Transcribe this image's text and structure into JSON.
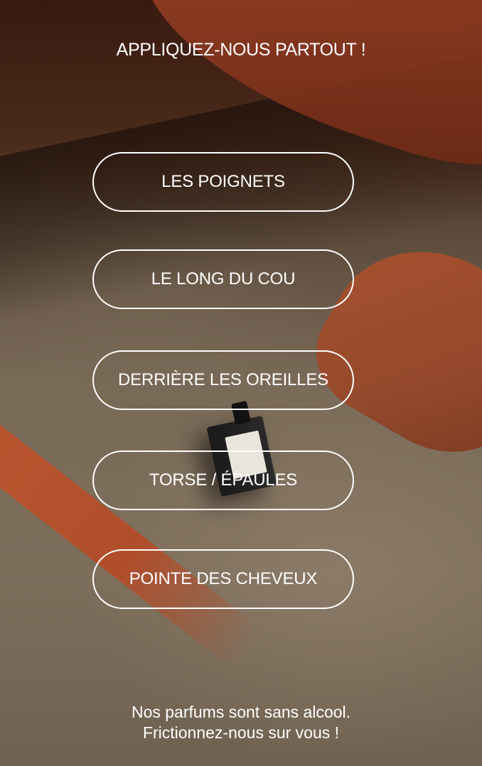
{
  "header": {
    "title": "APPLIQUEZ-NOUS PARTOUT !"
  },
  "options": [
    {
      "label": "LES POIGNETS"
    },
    {
      "label": "LE LONG DU COU"
    },
    {
      "label": "DERRIÈRE LES OREILLES"
    },
    {
      "label": "TORSE / ÉPAULES"
    },
    {
      "label": "POINTE DES CHEVEUX"
    }
  ],
  "footer": {
    "line1": "Nos parfums sont sans alcool.",
    "line2": "Frictionnez-nous sur vous !"
  },
  "colors": {
    "text": "#ffffff",
    "button_border": "#ffffff",
    "accent_terracotta": "#b54a26"
  }
}
